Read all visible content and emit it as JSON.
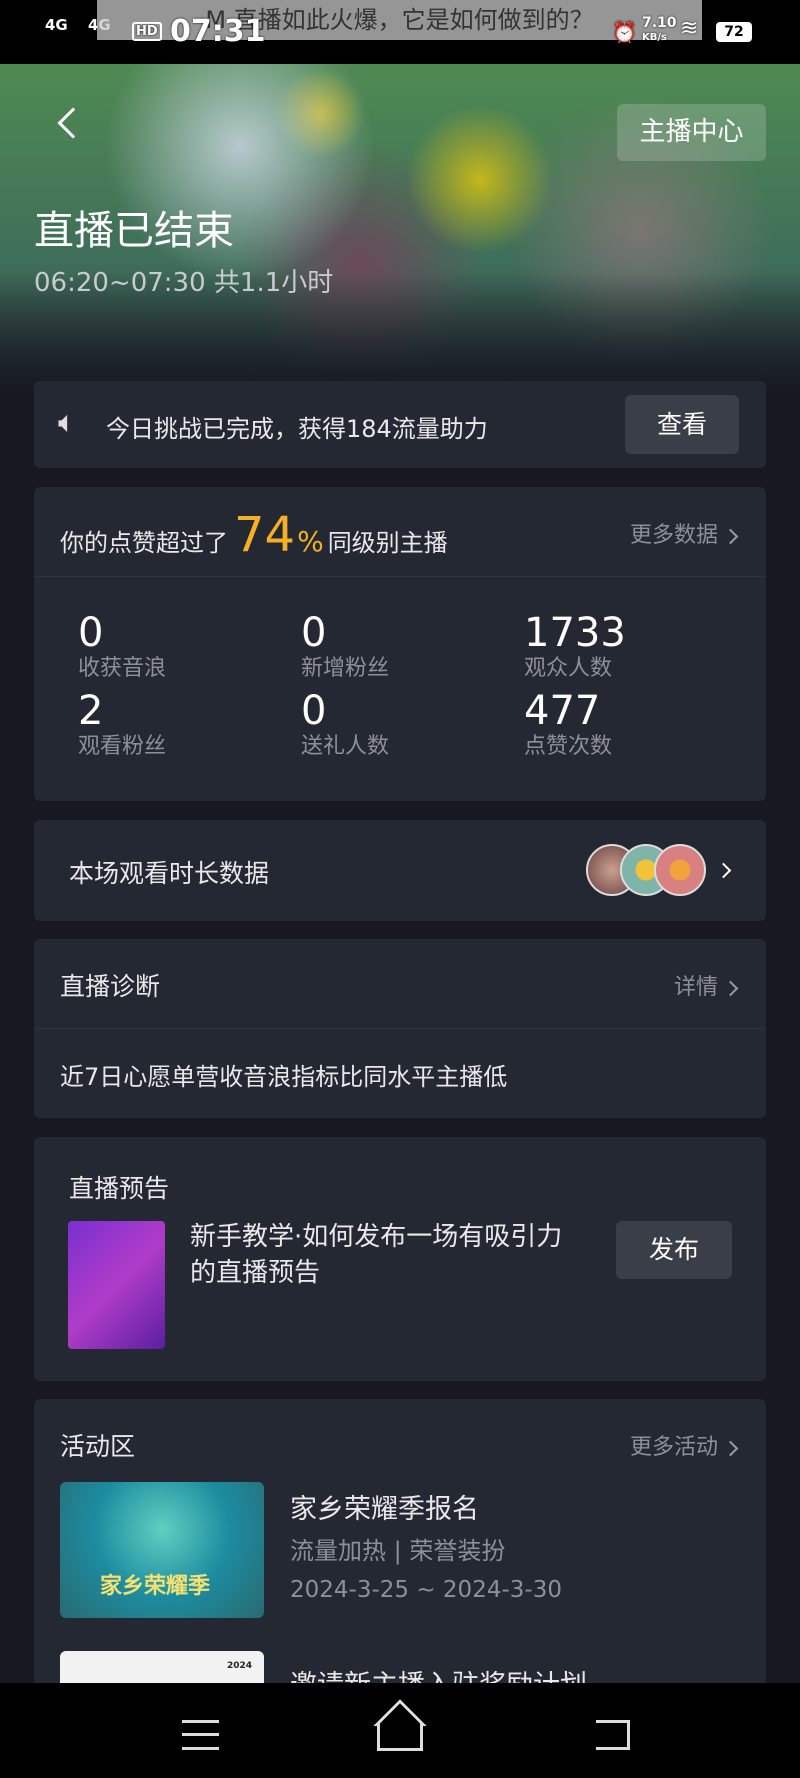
{
  "status_bar": {
    "signal1": "4G",
    "signal2": "4G",
    "hd": "HD",
    "time": "07:31",
    "speed": "7.10",
    "speed_unit": "KB/s",
    "battery": "72"
  },
  "watermark": "M 直播如此火爆，它是如何做到的？",
  "header": {
    "back_icon": "chevron-left-icon",
    "center_button": "主播中心",
    "title": "直播已结束",
    "time_range": "06:20~07:30 共1.1小时"
  },
  "challenge": {
    "icon": "speaker-icon",
    "text": "今日挑战已完成，获得184流量助力",
    "button": "查看"
  },
  "likes": {
    "prefix": "你的点赞超过了",
    "percent": "74",
    "percent_sign": "%",
    "suffix": "同级别主播",
    "more": "更多数据",
    "accent": "#f5b026",
    "stats": [
      {
        "value": "0",
        "label": "收获音浪"
      },
      {
        "value": "0",
        "label": "新增粉丝"
      },
      {
        "value": "1733",
        "label": "观众人数"
      },
      {
        "value": "2",
        "label": "观看粉丝"
      },
      {
        "value": "0",
        "label": "送礼人数"
      },
      {
        "value": "477",
        "label": "点赞次数"
      }
    ]
  },
  "watch_duration": {
    "title": "本场观看时长数据"
  },
  "diagnosis": {
    "title": "直播诊断",
    "more": "详情",
    "text": "近7日心愿单营收音浪指标比同水平主播低"
  },
  "preview": {
    "title": "直播预告",
    "item_title": "新手教学·如何发布一场有吸引力的直播预告",
    "button": "发布"
  },
  "activity": {
    "title": "活动区",
    "more": "更多活动",
    "items": [
      {
        "title": "家乡荣耀季报名",
        "tags": "流量加热 | 荣誉装扮",
        "date": "2024-3-25 ~ 2024-3-30",
        "banner_text": "家乡荣耀季"
      },
      {
        "title": "邀请新主播入驻奖励计划",
        "banner_text": "2024"
      }
    ]
  },
  "nav": {
    "menu": "menu-icon",
    "home": "home-icon",
    "back": "back-icon"
  }
}
